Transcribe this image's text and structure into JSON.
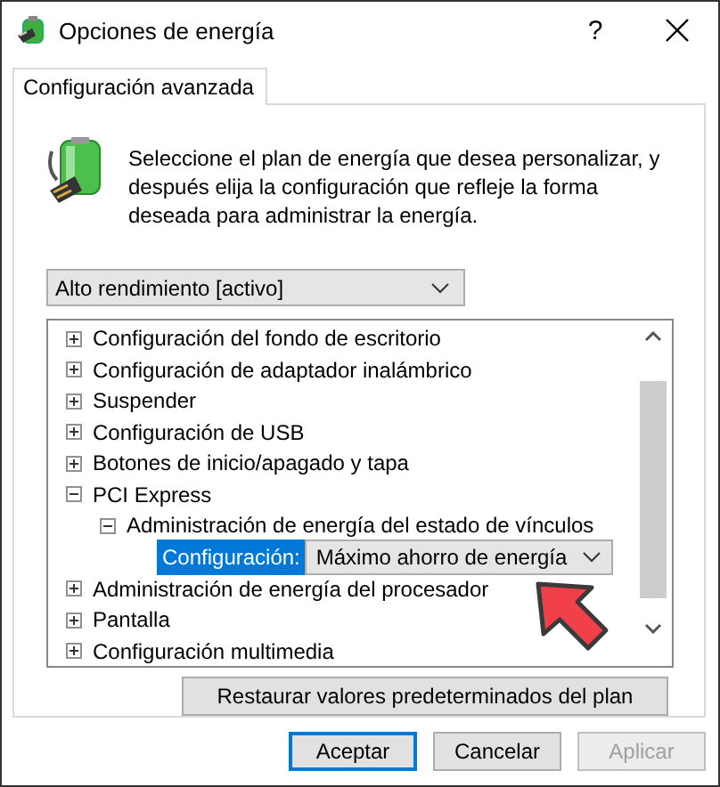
{
  "window": {
    "title": "Opciones de energía",
    "help": "?"
  },
  "tabs": [
    {
      "label": "Configuración avanzada",
      "selected": true
    }
  ],
  "description": "Seleccione el plan de energía que desea personalizar, y después elija la configuración que refleje la forma deseada para administrar la energía.",
  "plan_dropdown": {
    "value": "Alto rendimiento [activo]"
  },
  "settings_tree": [
    {
      "kind": "node",
      "label": "Configuración del fondo de escritorio",
      "expanded": false
    },
    {
      "kind": "node",
      "label": "Configuración de adaptador inalámbrico",
      "expanded": false
    },
    {
      "kind": "node",
      "label": "Suspender",
      "expanded": false
    },
    {
      "kind": "node",
      "label": "Configuración de USB",
      "expanded": false
    },
    {
      "kind": "node",
      "label": "Botones de inicio/apagado y tapa",
      "expanded": false
    },
    {
      "kind": "node",
      "label": "PCI Express",
      "expanded": true,
      "children": [
        {
          "kind": "node",
          "label": "Administración de energía del estado de vínculos",
          "expanded": true,
          "children": [
            {
              "kind": "setting",
              "label": "Configuración:",
              "value": "Máximo ahorro de energía",
              "selected": true
            }
          ]
        }
      ]
    },
    {
      "kind": "node",
      "label": "Administración de energía del procesador",
      "expanded": false
    },
    {
      "kind": "node",
      "label": "Pantalla",
      "expanded": false
    },
    {
      "kind": "node",
      "label": "Configuración multimedia",
      "expanded": false
    }
  ],
  "restore_button": "Restaurar valores predeterminados del plan",
  "buttons": [
    {
      "label": "Aceptar",
      "default": true,
      "disabled": false
    },
    {
      "label": "Cancelar",
      "default": false,
      "disabled": false
    },
    {
      "label": "Aplicar",
      "default": false,
      "disabled": true
    }
  ]
}
